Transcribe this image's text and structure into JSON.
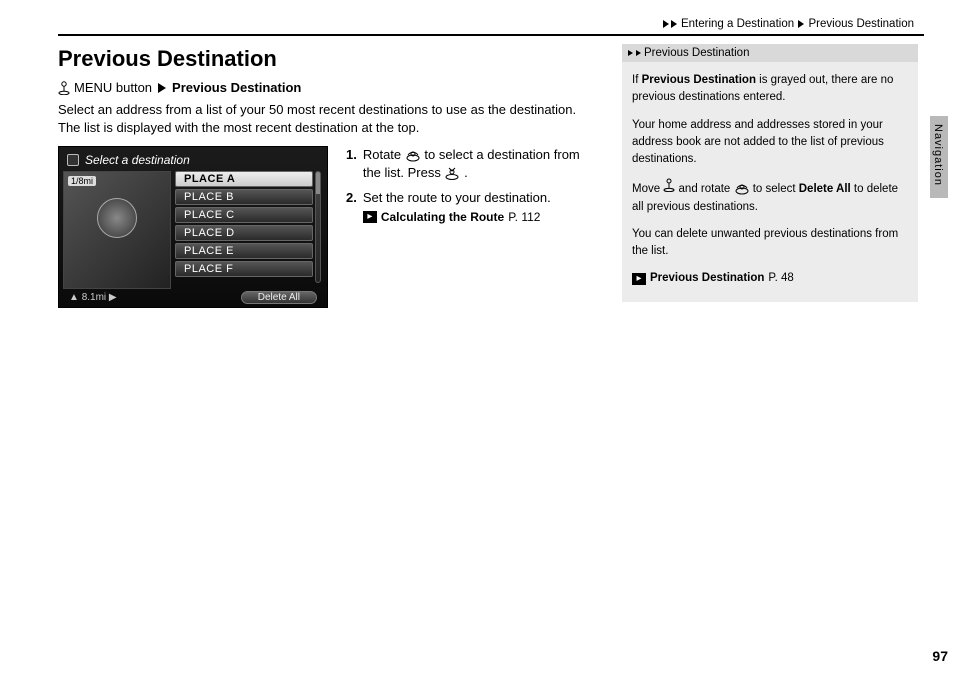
{
  "breadcrumb": {
    "seg1": "Entering a Destination",
    "seg2": "Previous Destination"
  },
  "title": "Previous Destination",
  "menuline": {
    "menu": "MENU button",
    "dest": "Previous Destination"
  },
  "intro": "Select an address from a list of your 50 most recent destinations to use as the destination. The list is displayed with the most recent destination at the top.",
  "screenshot": {
    "title": "Select a destination",
    "scale": "1/8mi",
    "rows": [
      "PLACE A",
      "PLACE B",
      "PLACE C",
      "PLACE D",
      "PLACE E",
      "PLACE F"
    ],
    "footer_dist": "8.1mi",
    "delete": "Delete All"
  },
  "steps": {
    "s1_a": "Rotate ",
    "s1_b": " to select a destination from the list. Press ",
    "s1_c": ".",
    "s2": "Set the route to your destination.",
    "ref": "Calculating the Route",
    "ref_page": "P. 112"
  },
  "sidebar": {
    "head": "Previous Destination",
    "p1_a": "If ",
    "p1_b": "Previous Destination",
    "p1_c": " is grayed out, there are no previous destinations entered.",
    "p2": "Your home address and addresses stored in your address book are not added to the list of previous destinations.",
    "p3_a": "Move ",
    "p3_b": " and rotate ",
    "p3_c": " to select ",
    "p3_d": "Delete All",
    "p3_e": " to delete all previous destinations.",
    "p4": "You can delete unwanted previous destinations from the list.",
    "ref": "Previous Destination",
    "ref_page": "P. 48"
  },
  "tab": "Navigation",
  "pagenum": "97"
}
